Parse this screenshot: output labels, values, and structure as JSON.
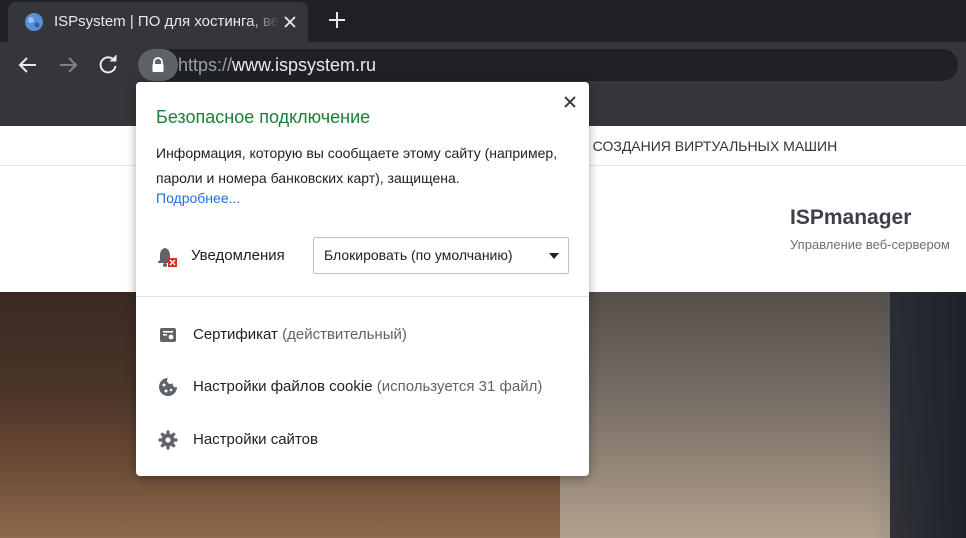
{
  "browser": {
    "tab_title": "ISPsystem | ПО для хостинга, веб",
    "url_protocol": "https://",
    "url_host": "www.ispsystem.ru"
  },
  "page": {
    "nav_text": "ДЛЯ СОЗДАНИЯ ВИРТУАЛЬНЫХ МАШИН",
    "product_title": "ISPmanager",
    "product_subtitle": "Управление веб-сервером"
  },
  "popup": {
    "title": "Безопасное подключение",
    "description": "Информация, которую вы сообщаете этому сайту (например, пароли и номера банковских карт), защищена.",
    "more_link": "Подробнее...",
    "permission": {
      "label": "Уведомления",
      "selected_option": "Блокировать (по умолчанию)"
    },
    "rows": {
      "certificate": {
        "label": "Сертификат",
        "note": "(действительный)"
      },
      "cookies": {
        "label": "Настройки файлов cookie",
        "note": "(используется 31 файл)"
      },
      "site_settings": {
        "label": "Настройки сайтов"
      }
    }
  },
  "colors": {
    "secure_green": "#188038",
    "link_blue": "#1a73e8",
    "chrome_dark": "#202124",
    "chrome_toolbar": "#35363a"
  },
  "icons": [
    "favicon-icon",
    "tab-close-icon",
    "plus-icon",
    "back-arrow-icon",
    "forward-arrow-icon",
    "reload-icon",
    "lock-icon",
    "close-icon",
    "bell-blocked-icon",
    "dropdown-arrow-icon",
    "certificate-icon",
    "cookie-icon",
    "gear-icon"
  ]
}
